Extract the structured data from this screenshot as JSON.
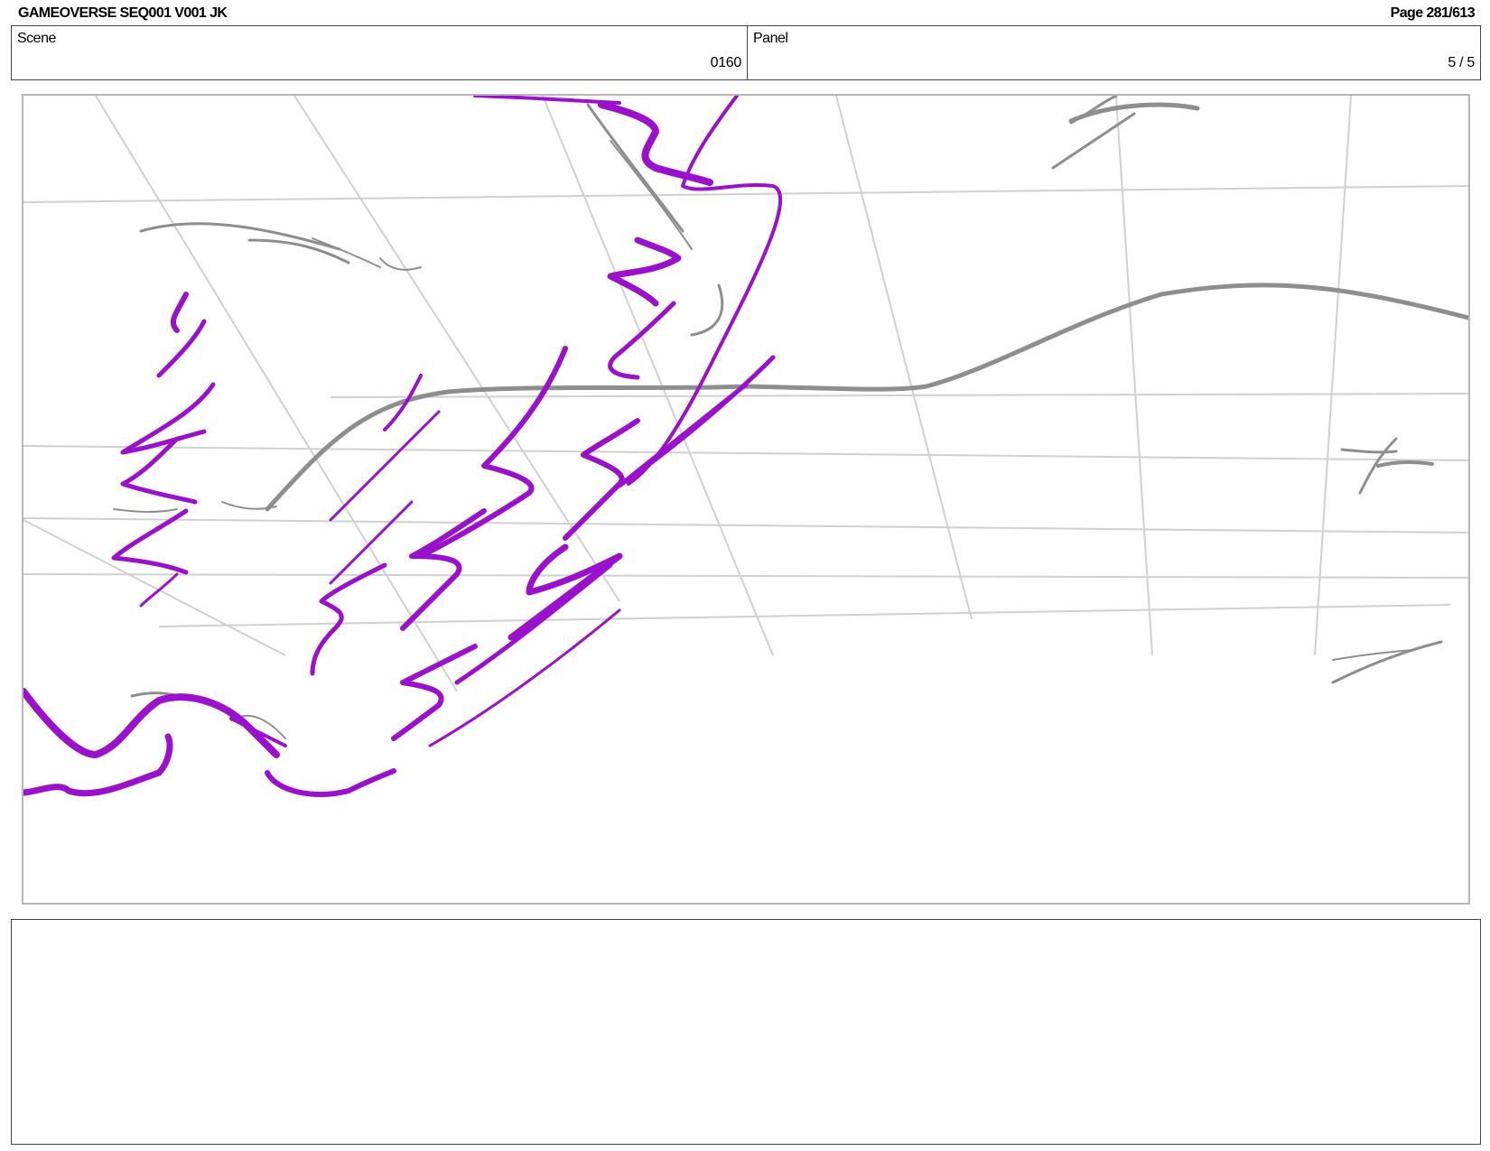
{
  "header": {
    "title": "GAMEOVERSE SEQ001 V001 JK",
    "page": "Page 281/613"
  },
  "info": {
    "scene_label": "Scene",
    "scene_value": "0160",
    "panel_label": "Panel",
    "panel_value": "5 / 5"
  },
  "drawing": {
    "stroke_colors": {
      "guide_lines": "#d0d0d0",
      "sketch_grey": "#8e8e8e",
      "effect_purple": "#9b10cc"
    }
  },
  "notes": {
    "text": ""
  }
}
